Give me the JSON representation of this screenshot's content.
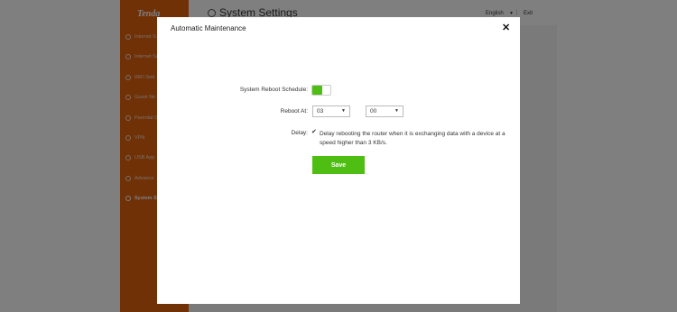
{
  "sidebar": {
    "logo": "Tenda",
    "items": [
      {
        "label": "Internet S",
        "icon": "globe-icon"
      },
      {
        "label": "Internet Se",
        "icon": "globe-icon"
      },
      {
        "label": "WiFi Sett",
        "icon": "wifi-icon"
      },
      {
        "label": "Guest Ne",
        "icon": "guest-icon"
      },
      {
        "label": "Parental C",
        "icon": "parental-icon"
      },
      {
        "label": "VPN",
        "icon": "vpn-icon"
      },
      {
        "label": "USB App",
        "icon": "usb-icon"
      },
      {
        "label": "Advance",
        "icon": "tools-icon"
      },
      {
        "label": "System S",
        "icon": "gear-icon",
        "active": true
      }
    ]
  },
  "header": {
    "title": "System Settings",
    "language": "English",
    "separator": "|",
    "exit": "Exit"
  },
  "modal": {
    "title": "Automatic Maintenance",
    "close": "✕",
    "schedule_label": "System Reboot Schedule:",
    "schedule_enabled": true,
    "reboot_at_label": "Reboot At:",
    "hour": "03",
    "minute": "00",
    "delay_label": "Delay:",
    "delay_checked": true,
    "delay_text": "Delay rebooting the router when it is exchanging data with a device at a speed higher than 3 KB/s.",
    "save_label": "Save"
  },
  "colors": {
    "brand_orange": "#e0620f",
    "accent_green": "#4fbe12"
  }
}
